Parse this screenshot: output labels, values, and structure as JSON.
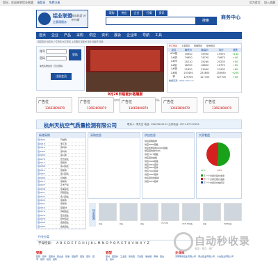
{
  "topbar": {
    "left": "您好，欢迎来到铝业联盟",
    "links": [
      "请登录",
      "免费注册"
    ],
    "right": [
      "设为首页",
      "加入收藏"
    ]
  },
  "logo": {
    "name": "铝业联盟",
    "subtitle": "企惠通服务",
    "slogan": "诚信联盟 合作共赢"
  },
  "cat_tabs": [
    "采购",
    "供应",
    "企业",
    "行情",
    "资讯"
  ],
  "search": {
    "placeholder": "",
    "button": "搜索"
  },
  "biz_label": "商务中心",
  "main_nav": [
    "首页",
    "企业",
    "产品",
    "采购",
    "供应",
    "资讯",
    "展会",
    "企业库",
    "导航",
    "工具"
  ],
  "ticker": "铝锭现货 供应商 广东南海 长江现货 上海期货 铝型材 铝棒 铝板带 铝箔",
  "login": {
    "user_label": "账号",
    "pass_label": "密码",
    "login_btn": "登陆",
    "free_reg": "免费注册会员",
    "forgot": "忘记密码",
    "reg_btn": "注册会员"
  },
  "banner": {
    "caption": "9月20日铝锭价格播报"
  },
  "news": "【播报】今日铝锭价格播报。现货均价上涨...2024-09-20 11:45:38，长江现货。上海：金属通讯频道每日行情播报",
  "price": {
    "tabs": [
      "长江现货",
      "上海现货",
      "南储现货",
      "伦敦现货"
    ],
    "headers": [
      "品名",
      "最低价",
      "最高价",
      "均价",
      "涨跌"
    ],
    "rows": [
      [
        "A00铝",
        "19950",
        "19990",
        "19970",
        "+140"
      ],
      [
        "1#铜",
        "74650",
        "74700",
        "74675",
        "+40"
      ],
      [
        "1#锌",
        "25210",
        "25260",
        "25235",
        "+50"
      ],
      [
        "1#铅",
        "16700",
        "16850",
        "16775",
        "+50"
      ],
      [
        "1#锡",
        "21820",
        "21990",
        "21905",
        "+80"
      ],
      [
        "1#镍",
        "253450",
        "253850",
        "253650",
        "+200"
      ],
      [
        "锌",
        "129700",
        "127700",
        "127700",
        "+50"
      ]
    ],
    "footer": "数据来源：www.ccmn.cn"
  },
  "ads": [
    {
      "label": "广告位",
      "phone": "13663800879"
    },
    {
      "label": "广告位",
      "phone": "13663800879"
    },
    {
      "label": "广告位",
      "phone": "13663800879"
    },
    {
      "label": "广告位",
      "phone": "13663800879"
    },
    {
      "label": "广告位",
      "phone": "13663800879"
    }
  ],
  "company": {
    "name": "杭州天杭空气质量检测有限公司",
    "contact": "联系人: 李先生  电话: 13663816101  业务电话: 0571-87707858"
  },
  "supply": {
    "title": "新增采购",
    "rows": [
      [
        "铝1600",
        "同城商"
      ],
      [
        "铝0213",
        "浙江商"
      ],
      [
        "铝0016",
        "原料商"
      ],
      [
        "铝4400",
        "原料商"
      ],
      [
        "铝0200",
        "嘉兴商"
      ],
      [
        "铝0279",
        "宏达铝业"
      ],
      [
        "铝0117",
        "贸易商"
      ],
      [
        "铝0098",
        "嘉兴铝业"
      ],
      [
        "铝0012",
        "贸易商"
      ],
      [
        "铝0007",
        "嘉兴铝业"
      ],
      [
        "铝0186",
        "同城商"
      ],
      [
        "铝0111",
        "贸易商"
      ],
      [
        "铝0197",
        "正木产业"
      ],
      [
        "铝0108",
        "佳美铝业"
      ],
      [
        "铝0101",
        "锌铝铝业"
      ],
      [
        "铝0100",
        "永兴铝业"
      ],
      [
        "铝0100",
        "贸易商"
      ],
      [
        "铝0101",
        "贸易商"
      ],
      [
        "铝0016",
        "铝型材"
      ],
      [
        "铝0079",
        "锌铝铝业"
      ],
      [
        "铝0076",
        "宏达铝业"
      ],
      [
        "铝0076",
        "阳光铝业"
      ],
      [
        "铝0168",
        "鑫鑫铝业"
      ],
      [
        "铝0008",
        "鑫鑫铝业"
      ]
    ]
  },
  "buy": {
    "title": "采购信息"
  },
  "sale": {
    "title": "供应信息",
    "items": [
      "供应铝卷板材",
      "供应6082铝板",
      "供应优质铝板(6061铝板)",
      "供应铝合金5083",
      "供应7075铝板",
      "供应铝合金板",
      "供应5A06铝板",
      "供应5052铝棒",
      "供应6063铝棒",
      "供应7A04铝棒",
      "供应5083铝棒",
      "供应铝合金圆棒",
      "供应2024铝棒"
    ]
  },
  "vote": {
    "title": "大家看盘",
    "percentages": [
      "52%",
      "48%"
    ],
    "options": [
      "下一个交易日铝价会涨",
      "下一个交易日铝价会跌",
      "下一个交易日价格持平"
    ]
  },
  "images": {
    "title": "特别推荐",
    "labels": [
      "铝板",
      "铝板",
      "铝板",
      "7075-T6",
      "7075-T6铝板",
      "铝板",
      "5083铝板"
    ]
  },
  "industry": {
    "title": "行业分类"
  },
  "alpha": {
    "label": "字母检索：",
    "letters": [
      "A",
      "B",
      "C",
      "D",
      "E",
      "F",
      "G",
      "H",
      "I",
      "J",
      "K",
      "L",
      "M",
      "N",
      "O",
      "P",
      "Q",
      "R",
      "S",
      "T",
      "U",
      "V",
      "W",
      "X",
      "Y",
      "Z"
    ]
  },
  "cats": [
    {
      "title": "铝板",
      "items": [
        "铝锭",
        "铝棒",
        "铝型材",
        "铝合金",
        "铝卷",
        "铝板带",
        "铝箔",
        "铝管",
        "铝带",
        "铝排",
        "铝线",
        "铝粉"
      ]
    },
    {
      "title": "铝型",
      "items": [
        "型材",
        "铝型材",
        "工业铝",
        "建筑铝",
        "门窗铝",
        "散热器",
        "幕墙",
        "铝合金",
        "铝条"
      ]
    },
    {
      "title": "企业库",
      "items": [
        "河南明泰铝业有限公司",
        "南山铝业有限公司",
        "宁波铝业有限公司"
      ]
    }
  ],
  "watermark": {
    "text": "自动秒收录",
    "sub": "收录 · 提交 · 推广"
  },
  "colors": {
    "primary": "#1c4f9c",
    "accent": "#c00000"
  }
}
